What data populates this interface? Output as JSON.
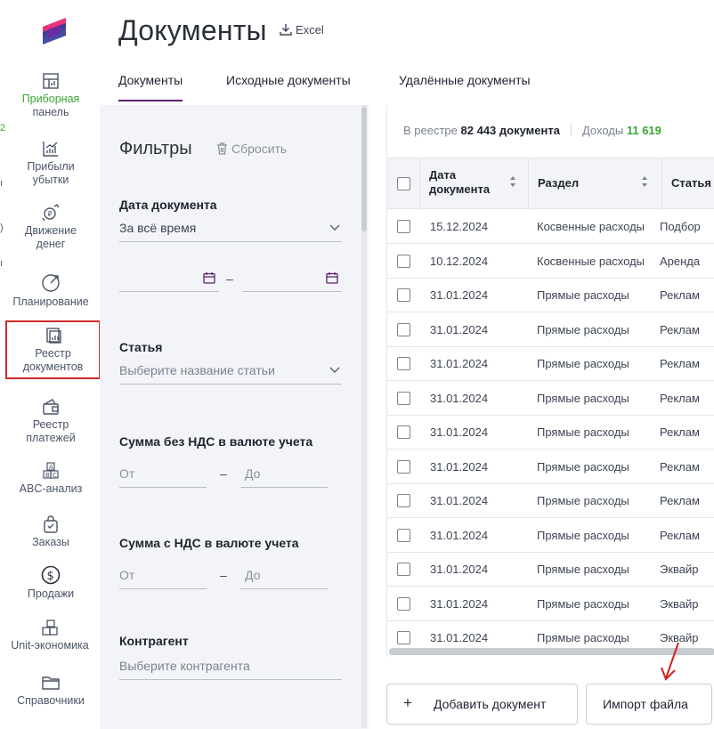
{
  "nav": {
    "items": [
      {
        "label_line1": "Приборная",
        "label_line2": "панель",
        "icon": "dashboard-icon"
      },
      {
        "label_line1": "Прибыли",
        "label_line2": "убытки",
        "icon": "profit-chart-icon"
      },
      {
        "label_line1": "Движение",
        "label_line2": "денег",
        "icon": "cash-flow-icon"
      },
      {
        "label_line1": "Планирование",
        "label_line2": "",
        "icon": "planning-icon"
      },
      {
        "label_line1": "Реестр",
        "label_line2": "документов",
        "icon": "documents-registry-icon"
      },
      {
        "label_line1": "Реестр",
        "label_line2": "платежей",
        "icon": "wallet-icon"
      },
      {
        "label_line1": "ABC-анализ",
        "label_line2": "",
        "icon": "abc-icon"
      },
      {
        "label_line1": "Заказы",
        "label_line2": "",
        "icon": "shopping-bag-icon"
      },
      {
        "label_line1": "Продажи",
        "label_line2": "",
        "icon": "dollar-icon"
      },
      {
        "label_line1": "Unit-экономика",
        "label_line2": "",
        "icon": "boxes-icon"
      },
      {
        "label_line1": "Справочники",
        "label_line2": "",
        "icon": "folder-icon"
      }
    ]
  },
  "header": {
    "title": "Документы",
    "excel_label": "Excel"
  },
  "tabs": [
    "Документы",
    "Исходные документы",
    "Удалённые документы"
  ],
  "filters": {
    "title": "Фильтры",
    "reset_label": "Сбросить",
    "date_label": "Дата документа",
    "date_value": "За всё время",
    "date_dash": "–",
    "article_label": "Статья",
    "article_placeholder": "Выберите название статьи",
    "sum_no_vat_label": "Сумма без НДС в валюте учета",
    "sum_vat_label": "Сумма с НДС в валюте учета",
    "from_placeholder": "От",
    "to_placeholder": "До",
    "range_dash": "–",
    "counterparty_label": "Контрагент",
    "counterparty_placeholder": "Выберите контрагента"
  },
  "summary": {
    "prefix": "В реестре",
    "count": "82 443 документа",
    "income_label": "Доходы",
    "income_value": "11 619"
  },
  "table": {
    "columns": [
      "Дата документа",
      "Раздел",
      "Статья"
    ],
    "rows": [
      {
        "date": "15.12.2024",
        "section": "Косвенные расходы",
        "article": "Подбор"
      },
      {
        "date": "10.12.2024",
        "section": "Косвенные расходы",
        "article": "Аренда"
      },
      {
        "date": "31.01.2024",
        "section": "Прямые расходы",
        "article": "Реклам"
      },
      {
        "date": "31.01.2024",
        "section": "Прямые расходы",
        "article": "Реклам"
      },
      {
        "date": "31.01.2024",
        "section": "Прямые расходы",
        "article": "Реклам"
      },
      {
        "date": "31.01.2024",
        "section": "Прямые расходы",
        "article": "Реклам"
      },
      {
        "date": "31.01.2024",
        "section": "Прямые расходы",
        "article": "Реклам"
      },
      {
        "date": "31.01.2024",
        "section": "Прямые расходы",
        "article": "Реклам"
      },
      {
        "date": "31.01.2024",
        "section": "Прямые расходы",
        "article": "Реклам"
      },
      {
        "date": "31.01.2024",
        "section": "Прямые расходы",
        "article": "Реклам"
      },
      {
        "date": "31.01.2024",
        "section": "Прямые расходы",
        "article": "Эквайр"
      },
      {
        "date": "31.01.2024",
        "section": "Прямые расходы",
        "article": "Эквайр"
      },
      {
        "date": "31.01.2024",
        "section": "Прямые расходы",
        "article": "Эквайр"
      }
    ]
  },
  "buttons": {
    "add_document": "Добавить документ",
    "add_symbol": "+",
    "import_file": "Импорт файла"
  },
  "colors": {
    "accent": "#5a1f6e",
    "highlight": "#cc2a2a",
    "income": "#3aa534"
  }
}
